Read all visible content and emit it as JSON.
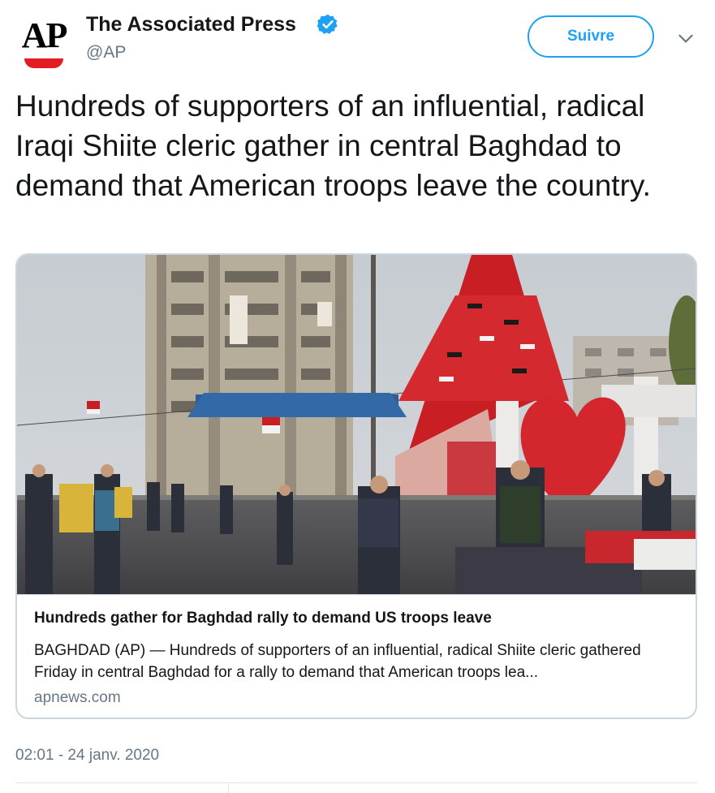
{
  "account": {
    "logo_text": "AP",
    "name": "The Associated Press",
    "handle": "@AP",
    "follow_label": "Suivre"
  },
  "tweet": {
    "text": "Hundreds of supporters of an influential, radical Iraqi Shiite cleric gather in central Baghdad to demand that American troops leave the country.",
    "timestamp": "02:01 - 24 janv. 2020"
  },
  "card": {
    "title": "Hundreds gather for Baghdad rally to demand US troops leave",
    "description": "BAGHDAD (AP) — Hundreds of supporters of an influential, radical Shiite cleric gathered Friday in central Baghdad for a rally to demand that American troops lea...",
    "domain": "apnews.com"
  },
  "colors": {
    "accent": "#1da1f2",
    "logo_red": "#e31b23",
    "secondary_text": "#657786"
  },
  "icons": [
    "ap-logo",
    "verified-icon",
    "chevron-down-icon"
  ]
}
